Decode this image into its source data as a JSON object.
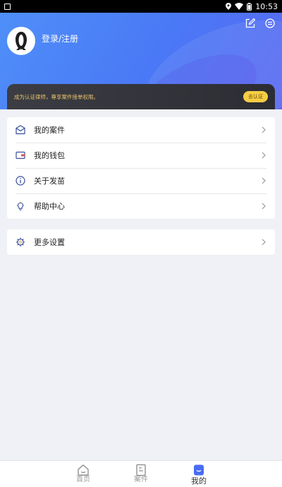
{
  "status_bar": {
    "time": "10:53"
  },
  "header": {
    "login_label": "登录/注册",
    "cert_text": "成为认证律师，尊享案件接单权限。",
    "cert_button": "去认证"
  },
  "menu": {
    "items": [
      {
        "label": "我的案件",
        "icon": "briefcase-icon"
      },
      {
        "label": "我的钱包",
        "icon": "wallet-icon"
      },
      {
        "label": "关于发苗",
        "icon": "info-icon"
      },
      {
        "label": "帮助中心",
        "icon": "lightbulb-icon"
      }
    ],
    "settings": {
      "label": "更多设置",
      "icon": "settings-icon"
    }
  },
  "bottom_nav": {
    "items": [
      {
        "label": "首页",
        "icon": "home-icon"
      },
      {
        "label": "案件",
        "icon": "document-icon"
      },
      {
        "label": "我的",
        "icon": "profile-icon",
        "active": true
      }
    ]
  },
  "colors": {
    "accent": "#4a7cf6",
    "cert_gold": "#f6cd45",
    "cert_text": "#e7c26a"
  }
}
